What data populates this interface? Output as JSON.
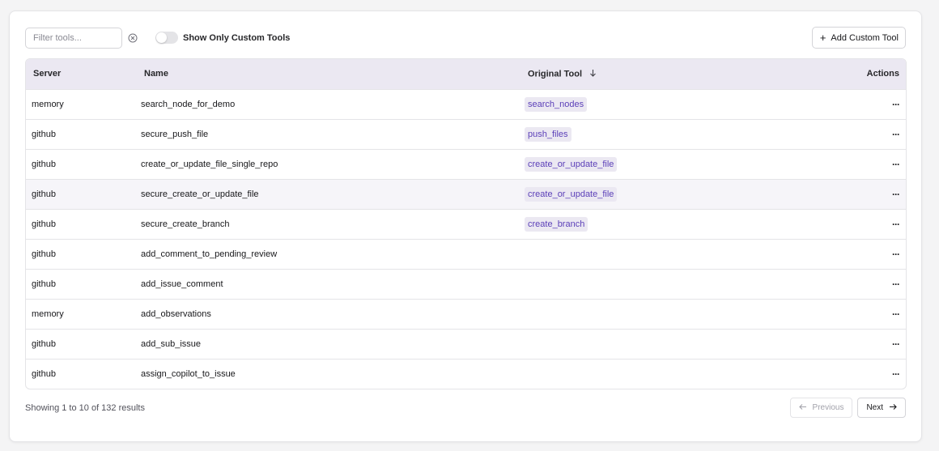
{
  "toolbar": {
    "filter_placeholder": "Filter tools...",
    "filter_value": "",
    "toggle_label": "Show Only Custom Tools",
    "toggle_on": false,
    "add_button_label": "Add Custom Tool"
  },
  "table": {
    "columns": {
      "server": "Server",
      "name": "Name",
      "original_tool": "Original Tool",
      "actions": "Actions"
    },
    "sort": {
      "column": "original_tool",
      "direction": "desc"
    },
    "rows": [
      {
        "server": "memory",
        "name": "search_node_for_demo",
        "original_tool": "search_nodes",
        "actions": "···"
      },
      {
        "server": "github",
        "name": "secure_push_file",
        "original_tool": "push_files",
        "actions": "···"
      },
      {
        "server": "github",
        "name": "create_or_update_file_single_repo",
        "original_tool": "create_or_update_file",
        "actions": "···"
      },
      {
        "server": "github",
        "name": "secure_create_or_update_file",
        "original_tool": "create_or_update_file",
        "actions": "···"
      },
      {
        "server": "github",
        "name": "secure_create_branch",
        "original_tool": "create_branch",
        "actions": "···"
      },
      {
        "server": "github",
        "name": "add_comment_to_pending_review",
        "original_tool": "",
        "actions": "···"
      },
      {
        "server": "github",
        "name": "add_issue_comment",
        "original_tool": "",
        "actions": "···"
      },
      {
        "server": "memory",
        "name": "add_observations",
        "original_tool": "",
        "actions": "···"
      },
      {
        "server": "github",
        "name": "add_sub_issue",
        "original_tool": "",
        "actions": "···"
      },
      {
        "server": "github",
        "name": "assign_copilot_to_issue",
        "original_tool": "",
        "actions": "···"
      }
    ]
  },
  "footer": {
    "results_text": "Showing 1 to 10 of 132 results",
    "previous_label": "Previous",
    "next_label": "Next",
    "previous_disabled": true
  },
  "colors": {
    "header_bg": "#ebe8f2",
    "badge_bg": "#ebe8f2",
    "badge_text": "#5b3fb8",
    "row_highlight": "#f6f5f9"
  }
}
